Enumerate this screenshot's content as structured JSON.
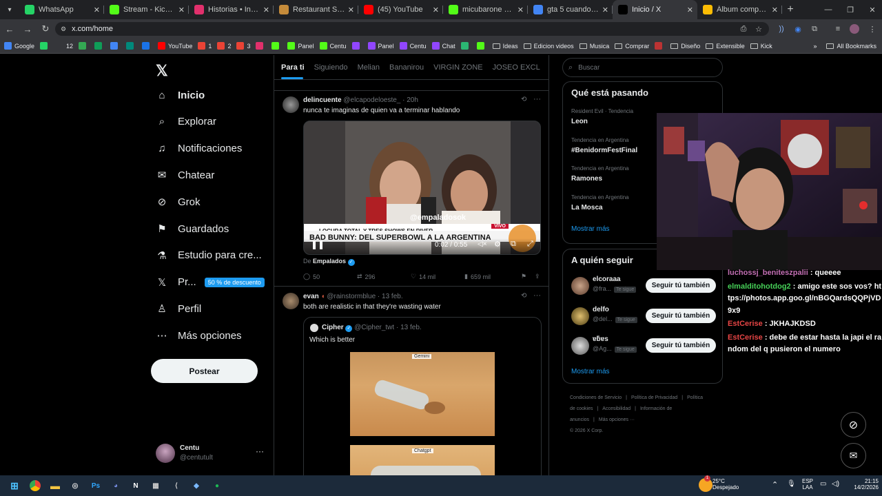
{
  "browser": {
    "tabs": [
      {
        "label": "WhatsApp",
        "icon": "whatsapp-icon",
        "color": "#25d366"
      },
      {
        "label": "Stream - Kick Dashboard",
        "icon": "kick-icon",
        "color": "#53fc18"
      },
      {
        "label": "Historias • Instagram",
        "icon": "instagram-icon",
        "color": "#e1306c"
      },
      {
        "label": "Restaurant Street",
        "icon": "restaurant-icon",
        "color": "#c58b3a"
      },
      {
        "label": "(45) YouTube",
        "icon": "youtube-icon",
        "color": "#ff0000"
      },
      {
        "label": "micubarone Stream -",
        "icon": "kick-icon",
        "color": "#53fc18"
      },
      {
        "label": "gta 5 cuando slaio -",
        "icon": "google-icon",
        "color": "#4285f4"
      },
      {
        "label": "Inicio / X",
        "icon": "x-icon",
        "color": "#000000",
        "active": true
      },
      {
        "label": "Álbum compartido:",
        "icon": "photos-icon",
        "color": "#fbbc04"
      }
    ],
    "url": "x.com/home",
    "bookmarks": [
      {
        "label": "Google",
        "type": "google"
      },
      {
        "label": "",
        "type": "whatsapp"
      },
      {
        "label": "12",
        "type": "plain"
      },
      {
        "label": "",
        "type": "drive"
      },
      {
        "label": "",
        "type": "sheets"
      },
      {
        "label": "",
        "type": "docs"
      },
      {
        "label": "",
        "type": "meet"
      },
      {
        "label": "",
        "type": "calendar"
      },
      {
        "label": "YouTube",
        "type": "youtube"
      },
      {
        "label": "1",
        "type": "gmail"
      },
      {
        "label": "2",
        "type": "gmail"
      },
      {
        "label": "3",
        "type": "gmail"
      },
      {
        "label": "",
        "type": "instagram"
      },
      {
        "label": "",
        "type": "kick"
      },
      {
        "label": "Panel",
        "type": "kick"
      },
      {
        "label": "Centu",
        "type": "kick"
      },
      {
        "label": "",
        "type": "twitch"
      },
      {
        "label": "Panel",
        "type": "twitch"
      },
      {
        "label": "Centu",
        "type": "twitch"
      },
      {
        "label": "Chat",
        "type": "twitch"
      },
      {
        "label": "",
        "type": "chat"
      },
      {
        "label": "",
        "type": "kick"
      },
      {
        "label": "Ideas",
        "type": "folder"
      },
      {
        "label": "Edicion videos",
        "type": "folder"
      },
      {
        "label": "Musica",
        "type": "folder"
      },
      {
        "label": "Comprar",
        "type": "folder"
      },
      {
        "label": "",
        "type": "misc"
      },
      {
        "label": "Diseño",
        "type": "folder"
      },
      {
        "label": "Extensible",
        "type": "folder"
      },
      {
        "label": "Kick",
        "type": "folder"
      }
    ],
    "all_bookmarks": "All Bookmarks"
  },
  "nav": {
    "items": [
      {
        "label": "Inicio",
        "icon": "home-icon",
        "bold": true
      },
      {
        "label": "Explorar",
        "icon": "search-icon"
      },
      {
        "label": "Notificaciones",
        "icon": "bell-icon"
      },
      {
        "label": "Chatear",
        "icon": "mail-icon"
      },
      {
        "label": "Grok",
        "icon": "grok-icon"
      },
      {
        "label": "Guardados",
        "icon": "bookmark-icon"
      },
      {
        "label": "Estudio para cre...",
        "icon": "flask-icon"
      },
      {
        "label": "Pr...",
        "icon": "x-premium-icon",
        "badge": "50 % de descuento"
      },
      {
        "label": "Perfil",
        "icon": "person-icon"
      },
      {
        "label": "Más opciones",
        "icon": "more-circle-icon"
      }
    ],
    "post_button": "Postear",
    "user": {
      "name": "Centu",
      "handle": "@centutult"
    }
  },
  "feed": {
    "tabs": [
      "Para ti",
      "Siguiendo",
      "Melian",
      "Bananirou",
      "VIRGIN ZONE",
      "JOSEO EXCL"
    ],
    "tweets": [
      {
        "author": "delincuente",
        "handle": "@elcapodeloeste_",
        "time": "· 20h",
        "text": "nunca te imaginas de quien va a terminar hablando",
        "video": {
          "overlay_handle": "@empaladosok",
          "ticker_small": "LOCURA TOTAL Y TRES SHOWS EN RIVER",
          "ticker_main": "BAD BUNNY: DEL SUPERBOWL A LA ARGENTINA",
          "live_tag": "VIVO",
          "time": "0:02 / 0:55"
        },
        "source_prefix": "De",
        "source": "Empalados",
        "stats": {
          "replies": "50",
          "retweets": "296",
          "likes": "14 mil",
          "views": "659 mil"
        }
      },
      {
        "author": "evan",
        "handle": "@rainstormblue",
        "time": "· 13 feb.",
        "text": "both are realistic in that they're wasting water",
        "quote": {
          "author": "Cipher",
          "handle": "@Cipher_twt",
          "time": "· 13 feb.",
          "text": "Which is better",
          "image_labels": [
            "Gemini",
            "Chatgpt"
          ]
        }
      }
    ]
  },
  "search": {
    "placeholder": "Buscar"
  },
  "trends": {
    "title": "Qué está pasando",
    "items": [
      {
        "meta": "Resident Evil · Tendencia",
        "name": "Leon"
      },
      {
        "meta": "Tendencia en Argentina",
        "name": "#BenidormFestFinal"
      },
      {
        "meta": "Tendencia en Argentina",
        "name": "Ramones"
      },
      {
        "meta": "Tendencia en Argentina",
        "name": "La Mosca"
      }
    ],
    "show_more": "Mostrar más"
  },
  "who_to_follow": {
    "title": "A quién seguir",
    "items": [
      {
        "name": "elcoraaa",
        "handle": "@fra...",
        "tag": "Te sigue",
        "button": "Seguir tú también"
      },
      {
        "name": "delfo",
        "handle": "@del...",
        "tag": "Te sigue",
        "button": "Seguir tú también"
      },
      {
        "name": "ɐƃɐs",
        "handle": "@Ag...",
        "tag": "Te sigue",
        "button": "Seguir tú también"
      }
    ],
    "show_more": "Mostrar más"
  },
  "footer": {
    "links": [
      "Condiciones de Servicio",
      "|",
      "Política de Privacidad",
      "|",
      "Política de cookies",
      "|",
      "Accesibilidad",
      "|",
      "Información de anuncios",
      "|",
      "Más opciones ···"
    ],
    "copyright": "© 2026 X Corp."
  },
  "chat": [
    {
      "user": "luchossj_beniteszpalii",
      "msg": " : queeee",
      "color": "#c36fb4"
    },
    {
      "user": "elmalditohotdog2",
      "msg": " : amigo este sos vos? https://photos.app.goo.gl/nBGQardsQQPjVD9x9",
      "color": "#46d058"
    },
    {
      "user": "EstCerise",
      "msg": " : JKHAJKDSD",
      "color": "#e64545"
    },
    {
      "user": "EstCerise",
      "msg": " : debe de estar hasta la japi el random del q pusieron el numero",
      "color": "#e64545"
    }
  ],
  "taskbar": {
    "weather": {
      "temp": "25°C",
      "cond": "Despejado",
      "badge": "1"
    },
    "lang": [
      "ESP",
      "LAA"
    ],
    "time": "21:15",
    "date": "14/2/2026"
  }
}
